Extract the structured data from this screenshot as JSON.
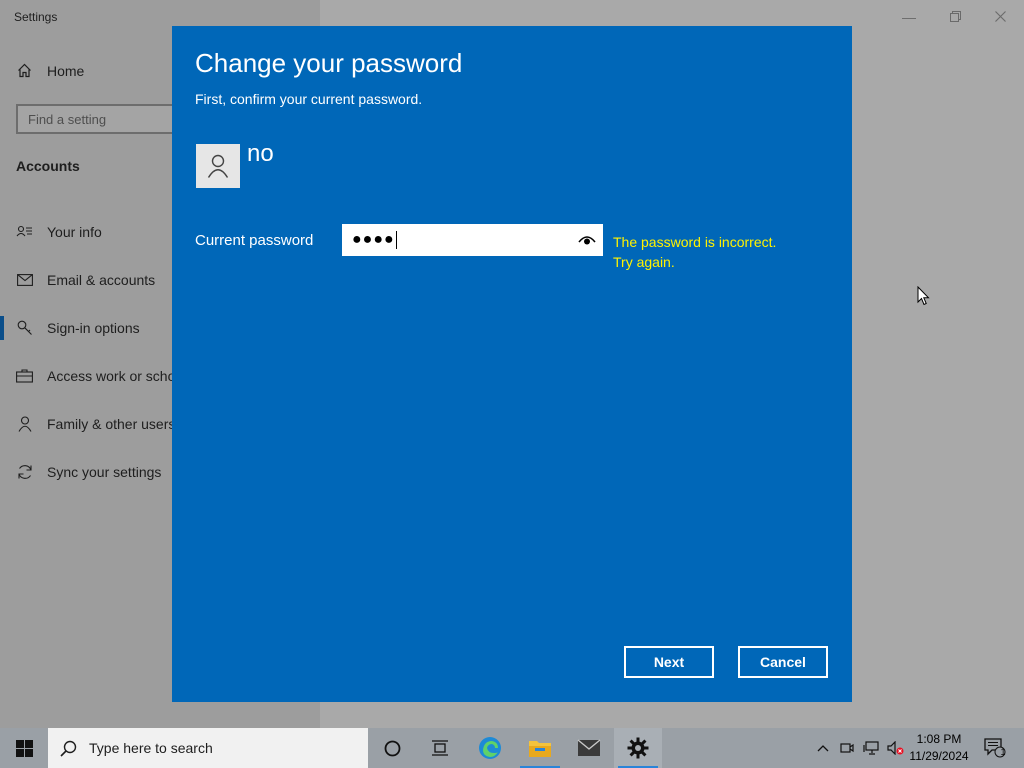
{
  "window": {
    "title": "Settings"
  },
  "sidebar": {
    "home_label": "Home",
    "search_placeholder": "Find a setting",
    "section_title": "Accounts",
    "items": [
      {
        "label": "Your info",
        "icon": "person-card-icon"
      },
      {
        "label": "Email & accounts",
        "icon": "mail-icon"
      },
      {
        "label": "Sign-in options",
        "icon": "key-icon",
        "selected": true
      },
      {
        "label": "Access work or scho",
        "icon": "briefcase-icon"
      },
      {
        "label": "Family & other users",
        "icon": "person-icon"
      },
      {
        "label": "Sync your settings",
        "icon": "sync-icon"
      }
    ]
  },
  "dialog": {
    "title": "Change your password",
    "subtitle": "First, confirm your current password.",
    "username": "no",
    "password_label": "Current password",
    "password_masked": "●●●●",
    "error_line1": "The password is incorrect.",
    "error_line2": "Try again.",
    "next_label": "Next",
    "cancel_label": "Cancel",
    "background_color": "#0067b8",
    "error_color": "#fff200"
  },
  "taskbar": {
    "search_placeholder": "Type here to search",
    "apps": [
      "cortana-icon",
      "task-view-icon",
      "edge-icon",
      "file-explorer-icon",
      "mail-icon",
      "settings-gear-icon"
    ],
    "time": "1:08 PM",
    "date": "11/29/2024",
    "notification_count": "1"
  }
}
